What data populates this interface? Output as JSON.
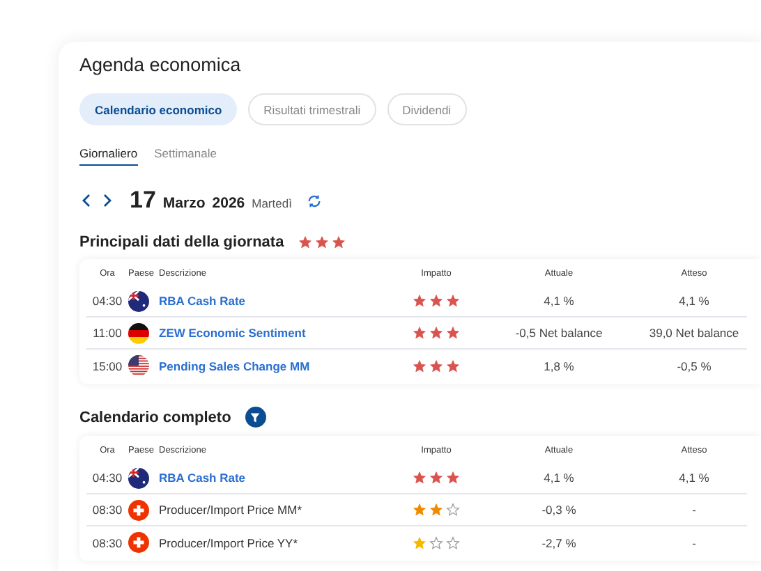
{
  "title": "Agenda economica",
  "pills": [
    {
      "label": "Calendario economico",
      "selected": true
    },
    {
      "label": "Risultati trimestrali",
      "selected": false
    },
    {
      "label": "Dividendi",
      "selected": false
    }
  ],
  "tabs": [
    {
      "label": "Giornaliero",
      "selected": true
    },
    {
      "label": "Settimanale",
      "selected": false
    }
  ],
  "date": {
    "day": "17",
    "month": "Marzo",
    "year": "2026",
    "weekday": "Martedì"
  },
  "sections": [
    {
      "title": "Principali dati della giornata",
      "kind": "highlights",
      "columns": [
        "Ora",
        "Paese",
        "Descrizione",
        "Impatto",
        "Attuale",
        "Atteso"
      ],
      "rows": [
        {
          "time": "04:30",
          "kind": "au",
          "description": "RBA Cash Rate",
          "highlighted": true,
          "stars": 3,
          "actual": "4,1 %",
          "expected": "4,1 %"
        },
        {
          "time": "11:00",
          "kind": "de",
          "description": "ZEW Economic Sentiment",
          "highlighted": true,
          "stars": 3,
          "actual": "-0,5 Net balance",
          "expected": "39,0 Net balance"
        },
        {
          "time": "15:00",
          "kind": "us",
          "description": "Pending Sales Change MM",
          "highlighted": true,
          "stars": 3,
          "actual": "1,8 %",
          "expected": "-0,5 %"
        }
      ]
    },
    {
      "title": "Calendario completo",
      "kind": "full",
      "columns": [
        "Ora",
        "Paese",
        "Descrizione",
        "Impatto",
        "Attuale",
        "Atteso"
      ],
      "rows": [
        {
          "time": "04:30",
          "kind": "au",
          "description": "RBA Cash Rate",
          "highlighted": true,
          "stars": 3,
          "actual": "4,1 %",
          "expected": "4,1 %"
        },
        {
          "time": "08:30",
          "kind": "ch",
          "description": "Producer/Import Price MM*",
          "highlighted": false,
          "stars": 2,
          "actual": "-0,3 %",
          "expected": "-"
        },
        {
          "time": "08:30",
          "kind": "ch",
          "description": "Producer/Import Price YY*",
          "highlighted": false,
          "stars": 1,
          "actual": "-2,7 %",
          "expected": "-"
        }
      ]
    }
  ]
}
